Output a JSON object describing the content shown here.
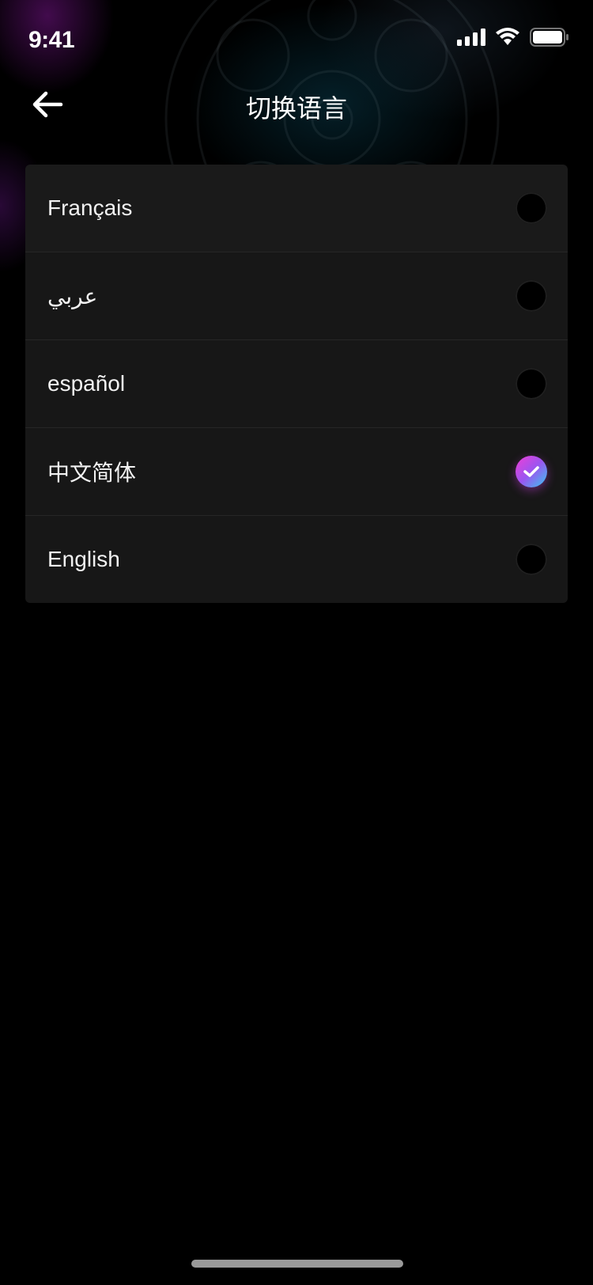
{
  "status_bar": {
    "time": "9:41"
  },
  "header": {
    "title": "切换语言",
    "back_icon": "arrow-left-icon"
  },
  "languages": [
    {
      "label": "Français",
      "selected": false
    },
    {
      "label": "عربي",
      "selected": false
    },
    {
      "label": "español",
      "selected": false
    },
    {
      "label": "中文简体",
      "selected": true
    },
    {
      "label": "English",
      "selected": false
    }
  ],
  "colors": {
    "background": "#000000",
    "list_background": "#171717",
    "divider": "#262626",
    "selected_gradient_start": "#f23dd6",
    "selected_gradient_end": "#38c8f0"
  }
}
